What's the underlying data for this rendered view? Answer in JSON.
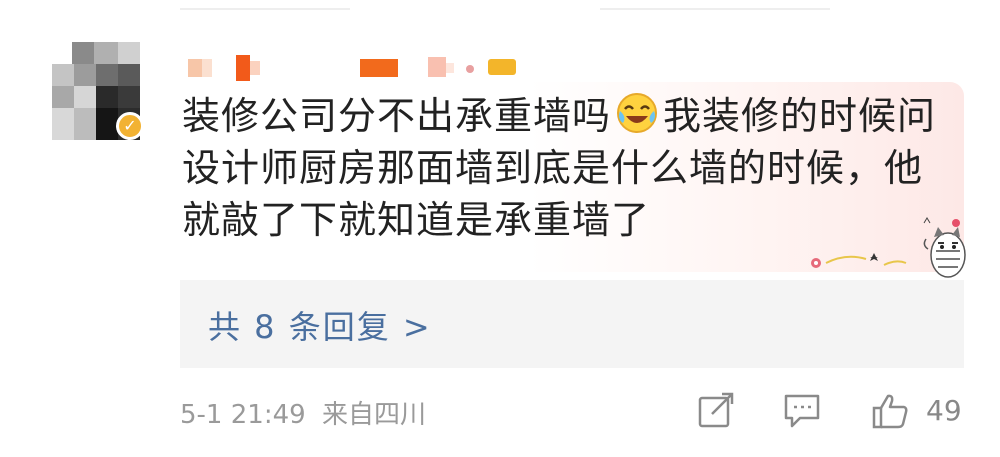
{
  "comment": {
    "lines": [
      "装修公司分不出承重墙吗",
      "我装修的时候问",
      "设计师厨房那面墙到底是什么墙的时候，他",
      "就敲了下就知道是承重墙了"
    ],
    "emoji": "laughing-crying-emoji"
  },
  "replies": {
    "label": "共 8 条回复 >"
  },
  "footer": {
    "timestamp": "5-1 21:49",
    "location": "来自四川",
    "like_count": "49"
  },
  "colors": {
    "link": "#4a6f9f",
    "meta": "#9a9a9a",
    "text": "#222222",
    "reply_bg": "#f4f4f4"
  },
  "icons": [
    "share-icon",
    "comment-icon",
    "like-icon",
    "verified-badge-icon"
  ]
}
